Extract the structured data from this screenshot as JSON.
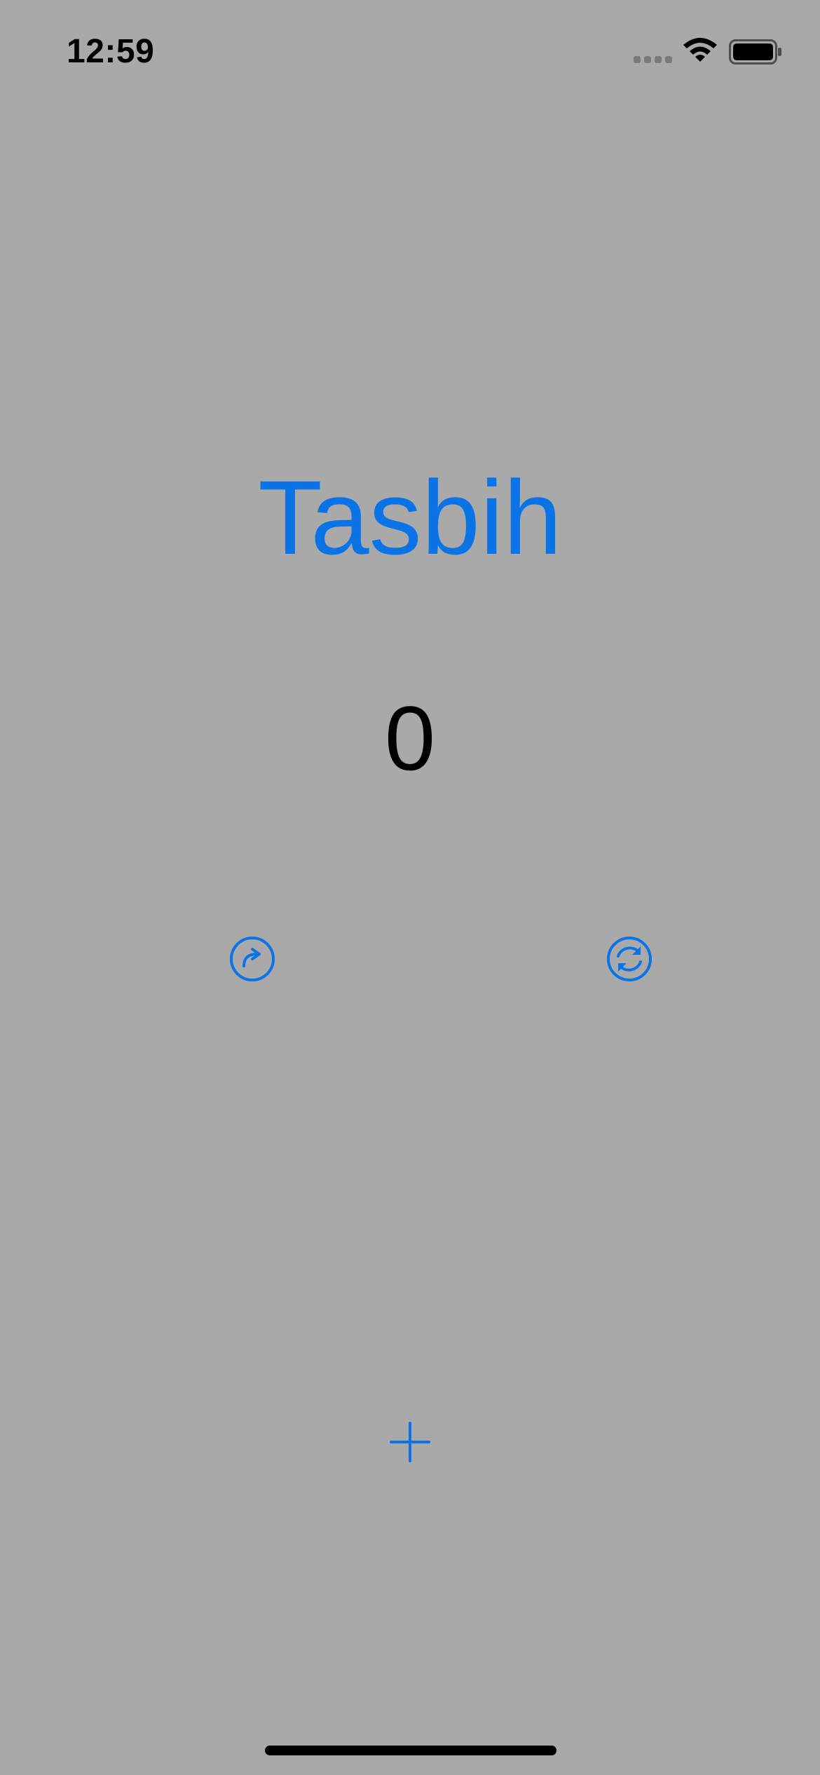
{
  "status_bar": {
    "time": "12:59",
    "signal_icon": "cellular-signal-icon",
    "wifi_icon": "wifi-icon",
    "battery_icon": "battery-icon"
  },
  "app": {
    "title": "Tasbih",
    "count": "0"
  },
  "controls": {
    "redo_icon": "redo-circle-icon",
    "reset_icon": "reset-cycle-icon",
    "plus_icon": "plus-icon"
  },
  "colors": {
    "background": "#a9a9a9",
    "accent": "#0a74e6",
    "text": "#000000"
  }
}
